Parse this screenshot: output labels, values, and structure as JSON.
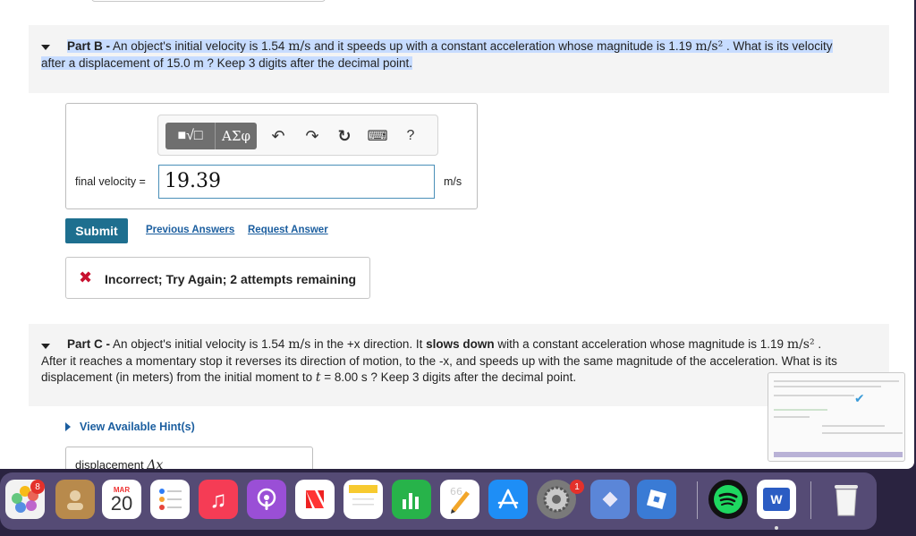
{
  "partB": {
    "label": "Part B -",
    "text1": " An object's initial velocity is 1.54 ",
    "unit_v": "m/s",
    "text2": " and it speeds up with a constant acceleration whose magnitude is 1.19 ",
    "unit_a": "m/s²",
    "text3": " . What is its velocity",
    "text4": "after a displacement of 15.0 m ? Keep 3 digits after the decimal point."
  },
  "toolbar": {
    "templates": "■√□",
    "greek": "ΑΣφ",
    "undo": "↶",
    "redo": "↷",
    "reset": "↻",
    "keyboard": "⌨",
    "help": "?"
  },
  "answer": {
    "label": "final velocity =",
    "value": "19.39",
    "unit": "m/s"
  },
  "actions": {
    "submit": "Submit",
    "previous": "Previous Answers",
    "request": "Request Answer"
  },
  "feedback": {
    "icon": "✖",
    "text": "Incorrect; Try Again; 2 attempts remaining"
  },
  "partC": {
    "label": "Part C -",
    "text1": " An object's initial velocity is 1.54 ",
    "unit_v": "m/s",
    "text2": " in the +x direction. It ",
    "bold": "slows down",
    "text3": " with a constant acceleration whose magnitude is 1.19 ",
    "unit_a": "m/s²",
    "text4": " .",
    "line2": "After it reaches a momentary stop it reverses its direction of motion, to the -x, and speeds up with the same magnitude of the acceleration. What is its",
    "line3a": "displacement (in meters) from the initial moment to ",
    "t": "t",
    "line3b": " = 8.00 s ? Keep 3 digits after the decimal point."
  },
  "hints": {
    "label": "View Available Hint(s)"
  },
  "displacement": {
    "label": "displacement ",
    "symbol": "Δx"
  },
  "dock": {
    "photos_badge": "8",
    "calendar_month": "MAR",
    "calendar_day": "20",
    "settings_badge": "1",
    "word_letter": "W"
  }
}
